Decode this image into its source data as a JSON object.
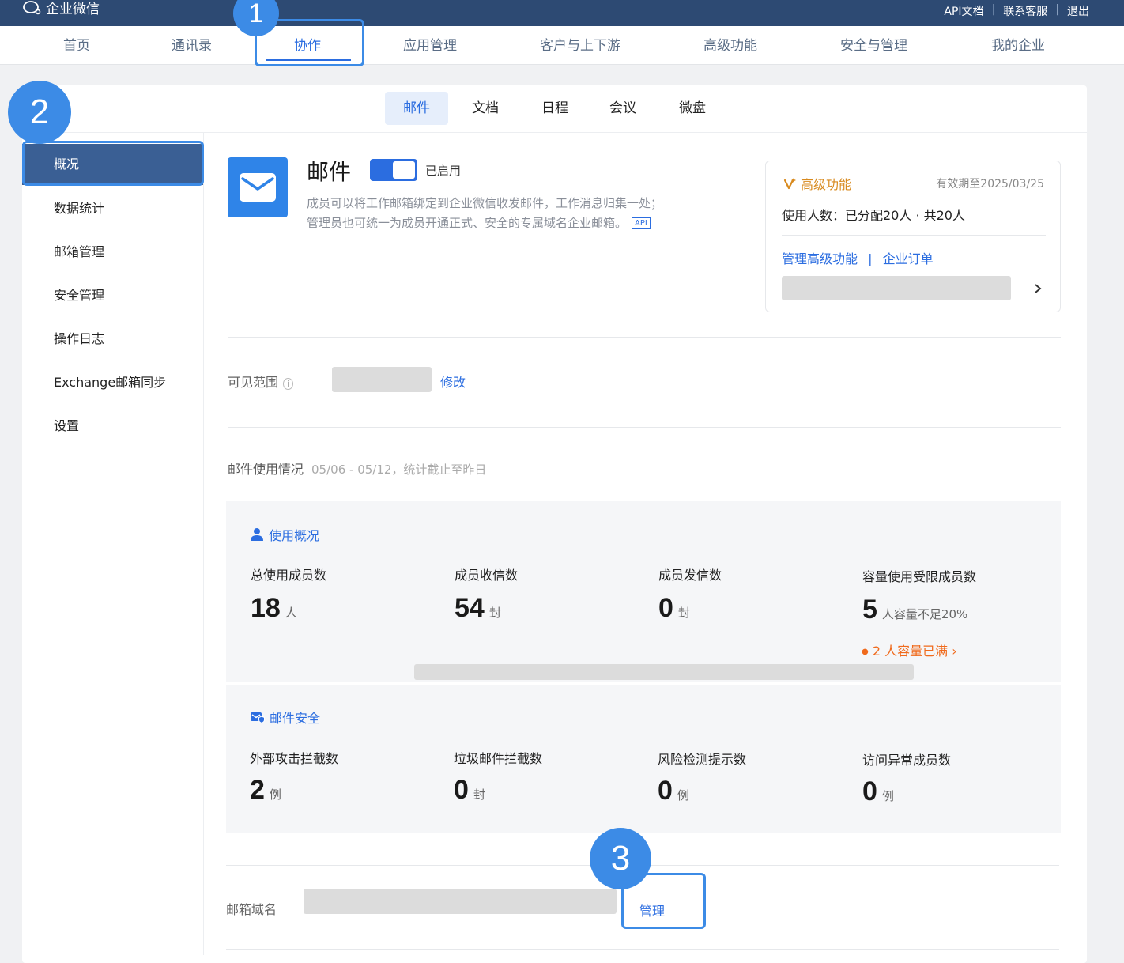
{
  "app": {
    "name": "企业微信"
  },
  "top_links": [
    "API文档",
    "联系客服",
    "退出"
  ],
  "main_nav": [
    {
      "label": "首页"
    },
    {
      "label": "通讯录"
    },
    {
      "label": "协作"
    },
    {
      "label": "应用管理"
    },
    {
      "label": "客户与上下游"
    },
    {
      "label": "高级功能"
    },
    {
      "label": "安全与管理"
    },
    {
      "label": "我的企业"
    }
  ],
  "sub_tabs": [
    {
      "label": "邮件"
    },
    {
      "label": "文档"
    },
    {
      "label": "日程"
    },
    {
      "label": "会议"
    },
    {
      "label": "微盘"
    }
  ],
  "sidebar": {
    "items": [
      {
        "label": "概况"
      },
      {
        "label": "数据统计"
      },
      {
        "label": "邮箱管理"
      },
      {
        "label": "安全管理"
      },
      {
        "label": "操作日志"
      },
      {
        "label": "Exchange邮箱同步"
      },
      {
        "label": "设置"
      }
    ]
  },
  "annotations": [
    "1",
    "2",
    "3"
  ],
  "mail": {
    "title": "邮件",
    "toggle_label": "已启用",
    "desc_line1": "成员可以将工作邮箱绑定到企业微信收发邮件，工作消息归集一处；",
    "desc_line2": "管理员也可统一为成员开通正式、安全的专属域名企业邮箱。",
    "api_tag": "API"
  },
  "advanced": {
    "title": "高级功能",
    "validity": "有效期至2025/03/25",
    "usage": "使用人数：已分配20人 · 共20人",
    "manage_link": "管理高级功能",
    "separator": "|",
    "order_link": "企业订单"
  },
  "visibility": {
    "label": "可见范围",
    "edit_link": "修改"
  },
  "usage_header": {
    "title": "邮件使用情况",
    "period": "05/06 - 05/12，统计截止至昨日"
  },
  "usage_overview": {
    "title": "使用概况",
    "stats": [
      {
        "label": "总使用成员数",
        "value": "18",
        "unit": "人"
      },
      {
        "label": "成员收信数",
        "value": "54",
        "unit": "封"
      },
      {
        "label": "成员发信数",
        "value": "0",
        "unit": "封"
      },
      {
        "label": "容量使用受限成员数",
        "value": "5",
        "unit": "人容量不足20%"
      }
    ],
    "full_note": "2 人容量已满"
  },
  "mail_security": {
    "title": "邮件安全",
    "stats": [
      {
        "label": "外部攻击拦截数",
        "value": "2",
        "unit": "例"
      },
      {
        "label": "垃圾邮件拦截数",
        "value": "0",
        "unit": "封"
      },
      {
        "label": "风险检测提示数",
        "value": "0",
        "unit": "例"
      },
      {
        "label": "访问异常成员数",
        "value": "0",
        "unit": "例"
      }
    ]
  },
  "domain": {
    "label": "邮箱域名",
    "manage_link": "管理"
  },
  "colors": {
    "accent": "#2b6de0",
    "topbar": "#2d4a73",
    "highlight": "#3c8be6",
    "warning": "#f06a1c",
    "gold": "#d88a1e"
  }
}
